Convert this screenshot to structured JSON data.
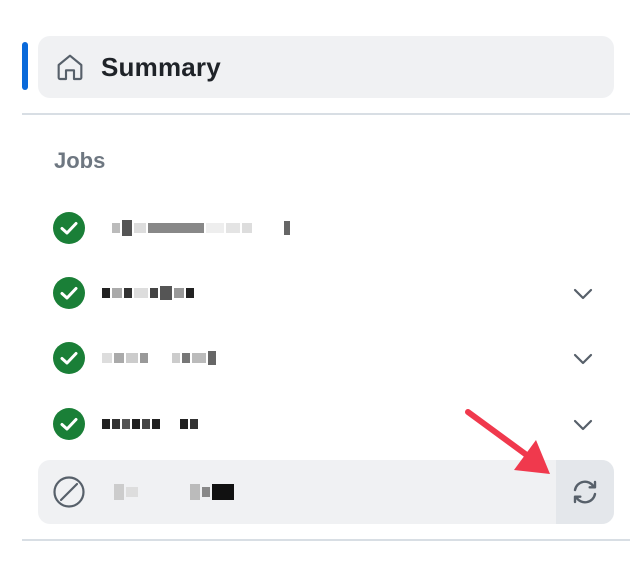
{
  "summary": {
    "label": "Summary",
    "icon": "home-icon"
  },
  "jobs": {
    "heading": "Jobs",
    "items": [
      {
        "status": "success",
        "status_icon": "check-circle-icon",
        "name": "",
        "expandable": false
      },
      {
        "status": "success",
        "status_icon": "check-circle-icon",
        "name": "",
        "expandable": true
      },
      {
        "status": "success",
        "status_icon": "check-circle-icon",
        "name": "",
        "expandable": true
      },
      {
        "status": "success",
        "status_icon": "check-circle-icon",
        "name": "",
        "expandable": true
      },
      {
        "status": "cancelled",
        "status_icon": "skipped-icon",
        "name": "",
        "expandable": false,
        "selected": true,
        "action_icon": "rerun-icon"
      }
    ]
  },
  "colors": {
    "accent": "#0969da",
    "success": "#1a7f37",
    "annotation_arrow": "#f0394d",
    "selected_bg": "#f0f1f3"
  }
}
